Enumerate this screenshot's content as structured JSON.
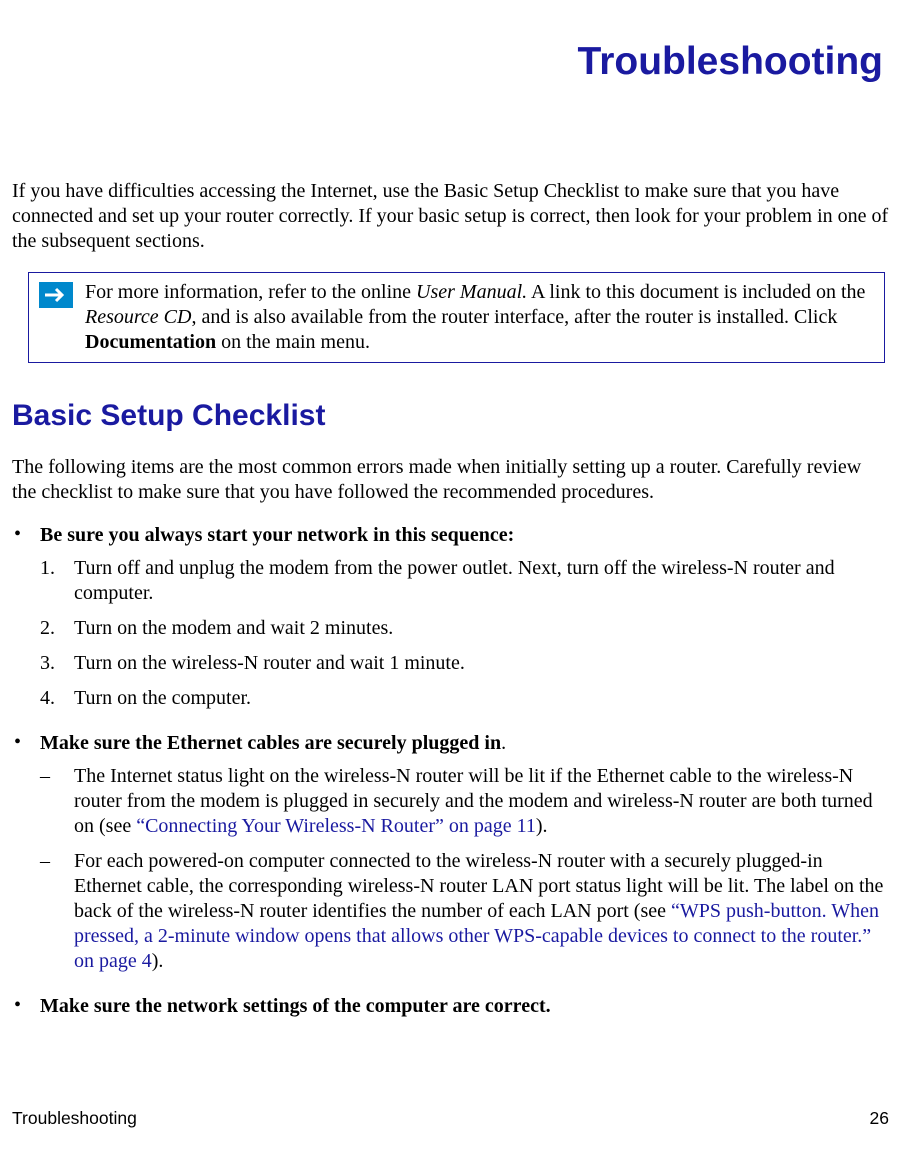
{
  "chapter_title": "Troubleshooting",
  "intro": "If you have difficulties accessing the Internet, use the Basic Setup Checklist to make sure that you have connected and set up your router correctly. If your basic setup is correct, then look for your problem in one of the subsequent sections.",
  "note": {
    "pre": "For more information, refer to the online ",
    "italic1": "User Manual.",
    "mid1": " A link to this document is included on the ",
    "italic2": "Resource CD",
    "mid2": ", and is also available from the router interface, after the router is installed. Click ",
    "bold": "Documentation",
    "post": " on the main menu."
  },
  "section_heading": "Basic Setup Checklist",
  "section_intro": "The following items are the most common errors made when initially setting up a router. Carefully review the checklist to make sure that you have followed the recommended procedures.",
  "bullets": [
    {
      "bold_text": "Be sure you always start your network in this sequence:",
      "plain_after": "",
      "numbered": [
        "Turn off and unplug the modem from the power outlet. Next, turn off the wireless-N router and computer.",
        "Turn on the modem and wait 2 minutes.",
        "Turn on the wireless-N router and wait 1 minute.",
        "Turn on the computer."
      ]
    },
    {
      "bold_text": "Make sure the Ethernet cables are securely plugged in",
      "plain_after": ".",
      "subs": [
        {
          "pre": "The Internet status light on the wireless-N router will be lit if the Ethernet cable to the wireless-N router from the modem is plugged in securely and the modem and wireless-N router are both turned on (see ",
          "link": "“Connecting Your Wireless-N Router” on page 11",
          "post": ")."
        },
        {
          "pre": "For each powered-on computer connected to the wireless-N router with a securely plugged-in Ethernet cable, the corresponding wireless-N router LAN port status light will be lit. The label on the back of the wireless-N router identifies the number of each LAN port (see ",
          "link": "“WPS push-button. When pressed, a 2-minute window opens that allows other WPS-capable devices to connect to the router.” on page 4",
          "post": ")."
        }
      ]
    },
    {
      "bold_text": "Make sure the network settings of the computer are correct.",
      "plain_after": ""
    }
  ],
  "footer": {
    "left": "Troubleshooting",
    "right": "26"
  }
}
